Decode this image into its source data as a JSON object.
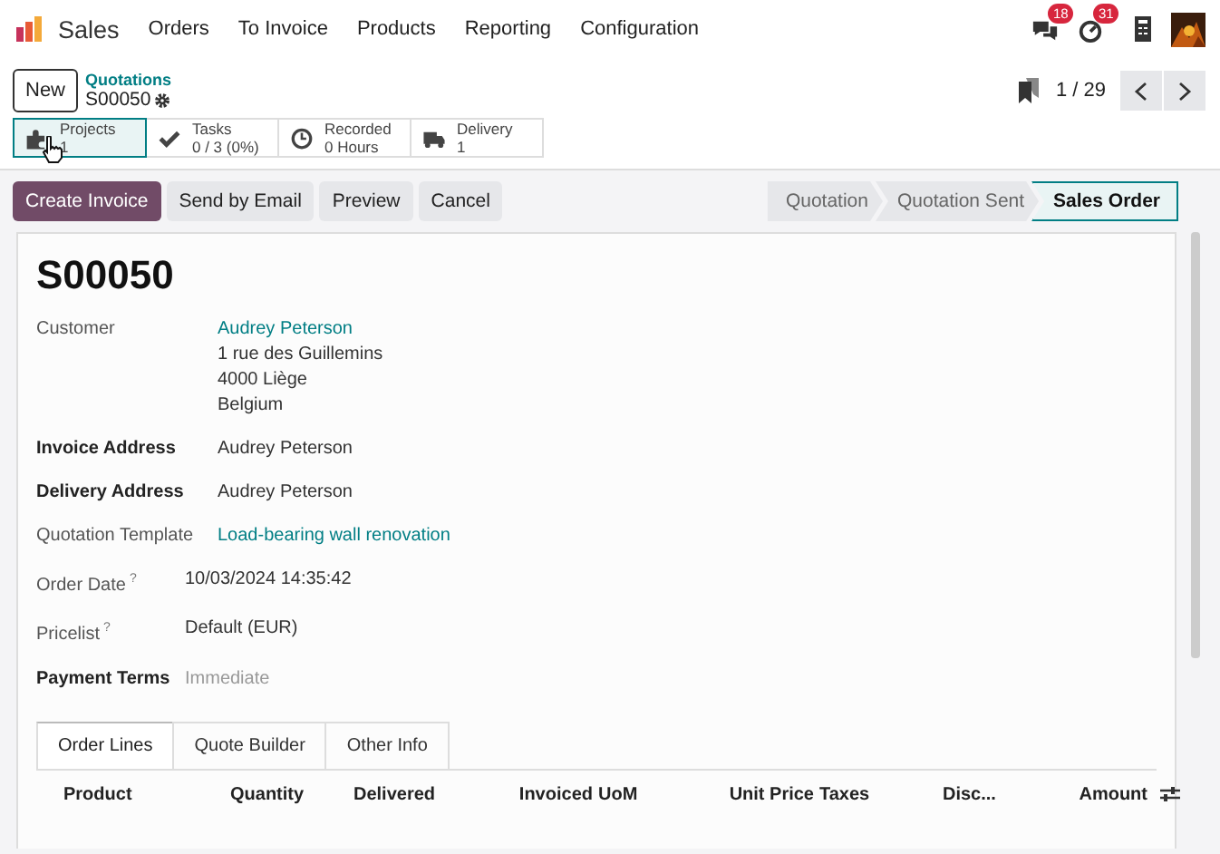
{
  "navbar": {
    "app": "Sales",
    "menu": [
      "Orders",
      "To Invoice",
      "Products",
      "Reporting",
      "Configuration"
    ],
    "badges": [
      {
        "kind": "chat",
        "count": "18"
      },
      {
        "kind": "activity",
        "count": "31"
      }
    ]
  },
  "breadcrumb": {
    "new_button": "New",
    "parent": "Quotations",
    "current": "S00050"
  },
  "pager": {
    "text": "1 / 29"
  },
  "smart_buttons": [
    {
      "kind": "projects",
      "label": "Projects",
      "value": "1",
      "selected": true
    },
    {
      "kind": "tasks",
      "label": "Tasks",
      "value": "0 / 3 (0%)",
      "selected": false
    },
    {
      "kind": "recorded",
      "label": "Recorded",
      "value": "0 Hours",
      "selected": false
    },
    {
      "kind": "delivery",
      "label": "Delivery",
      "value": "1",
      "selected": false
    }
  ],
  "actions": [
    {
      "label": "Create Invoice",
      "primary": true
    },
    {
      "label": "Send by Email",
      "primary": false
    },
    {
      "label": "Preview",
      "primary": false
    },
    {
      "label": "Cancel",
      "primary": false
    }
  ],
  "stages": [
    {
      "label": "Quotation",
      "selected": false
    },
    {
      "label": "Quotation Sent",
      "selected": false
    },
    {
      "label": "Sales Order",
      "selected": true
    }
  ],
  "title": "S00050",
  "field_groups": [
    [
      {
        "label": "Customer",
        "bold": false,
        "kind": "link",
        "value": "Audrey Peterson",
        "lines": [
          "1 rue des Guillemins",
          "4000 Liège",
          "Belgium"
        ]
      },
      {
        "label": "Invoice Address",
        "bold": true,
        "kind": "plain",
        "value": "Audrey Peterson"
      },
      {
        "label": "Delivery Address",
        "bold": true,
        "kind": "plain",
        "value": "Audrey Peterson"
      },
      {
        "label": "Quotation Template",
        "bold": false,
        "kind": "link",
        "value": "Load-bearing wall renovation"
      }
    ],
    [
      {
        "label": "Order Date",
        "help": "?",
        "bold": false,
        "kind": "plain",
        "value": "10/03/2024 14:35:42"
      },
      {
        "label": "Pricelist",
        "help": "?",
        "bold": false,
        "kind": "plain",
        "value": "Default (EUR)"
      },
      {
        "label": "Payment Terms",
        "bold": true,
        "placeholder": "Immediate"
      }
    ]
  ],
  "tabs": [
    {
      "label": "Order Lines",
      "selected": true
    },
    {
      "label": "Quote Builder",
      "selected": false
    },
    {
      "label": "Other Info",
      "selected": false
    }
  ],
  "table": {
    "columns": [
      "Product",
      "Quantity",
      "Delivered",
      "Invoiced",
      "UoM",
      "Unit Price",
      "Taxes",
      "Disc...",
      "Amount"
    ]
  }
}
